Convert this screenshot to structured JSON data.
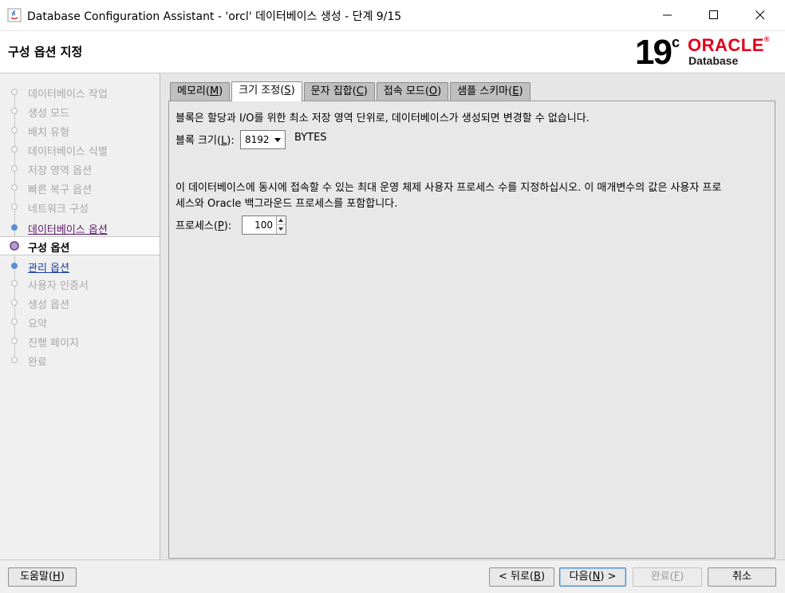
{
  "window": {
    "title": "Database Configuration Assistant - 'orcl' 데이터베이스 생성 - 단계 9/15"
  },
  "header": {
    "page_title": "구성 옵션 지정",
    "logo_version": "19",
    "logo_sup": "c",
    "logo_brand": "ORACLE",
    "logo_product": "Database"
  },
  "sidebar": {
    "steps": [
      {
        "label": "데이터베이스 작업",
        "state": "done"
      },
      {
        "label": "생성 모드",
        "state": "done"
      },
      {
        "label": "배치 유형",
        "state": "done"
      },
      {
        "label": "데이터베이스 식별",
        "state": "done"
      },
      {
        "label": "저장 영역 옵션",
        "state": "done"
      },
      {
        "label": "빠른 복구 옵션",
        "state": "done"
      },
      {
        "label": "네트워크 구성",
        "state": "done"
      },
      {
        "label": "데이터베이스 옵션",
        "state": "visited"
      },
      {
        "label": "구성 옵션",
        "state": "current"
      },
      {
        "label": "관리 옵션",
        "state": "next"
      },
      {
        "label": "사용자 인증서",
        "state": "pending"
      },
      {
        "label": "생성 옵션",
        "state": "pending"
      },
      {
        "label": "요약",
        "state": "pending"
      },
      {
        "label": "진행 페이지",
        "state": "pending"
      },
      {
        "label": "완료",
        "state": "pending"
      }
    ]
  },
  "tabs": [
    {
      "pre": "메모리(",
      "key": "M",
      "post": ")"
    },
    {
      "pre": "크기 조정(",
      "key": "S",
      "post": ")",
      "active": true
    },
    {
      "pre": "문자 집합(",
      "key": "C",
      "post": ")"
    },
    {
      "pre": "접속 모드(",
      "key": "O",
      "post": ")"
    },
    {
      "pre": "샘플 스키마(",
      "key": "E",
      "post": ")"
    }
  ],
  "sizing": {
    "block_description": "블록은 할당과 I/O를 위한 최소 저장 영역 단위로, 데이터베이스가 생성되면 변경할 수 없습니다.",
    "block_label_pre": "블록 크기(",
    "block_label_key": "L",
    "block_label_post": "):",
    "block_size_value": "8192",
    "block_unit": "BYTES",
    "process_description_line1": "이 데이터베이스에 동시에 접속할 수 있는 최대 운영 체제 사용자 프로세스 수를 지정하십시오. 이 매개변수의 값은 사용자 프로",
    "process_description_line2": "세스와 Oracle 백그라운드 프로세스를 포함합니다.",
    "process_label_pre": "프로세스(",
    "process_label_key": "P",
    "process_label_post": "):",
    "process_value": "100"
  },
  "buttons": {
    "help": {
      "pre": "도움말(",
      "key": "H",
      "post": ")"
    },
    "back": {
      "pre": "< 뒤로(",
      "key": "B",
      "post": ")"
    },
    "next": {
      "pre": "다음(",
      "key": "N",
      "post": ") >"
    },
    "finish": {
      "pre": "완료(",
      "key": "F",
      "post": ")"
    },
    "cancel": {
      "label": "취소"
    }
  },
  "colors": {
    "oracle_red": "#e0001b",
    "current_step": "#7b5a98",
    "link_blue": "#1c3f9e"
  }
}
